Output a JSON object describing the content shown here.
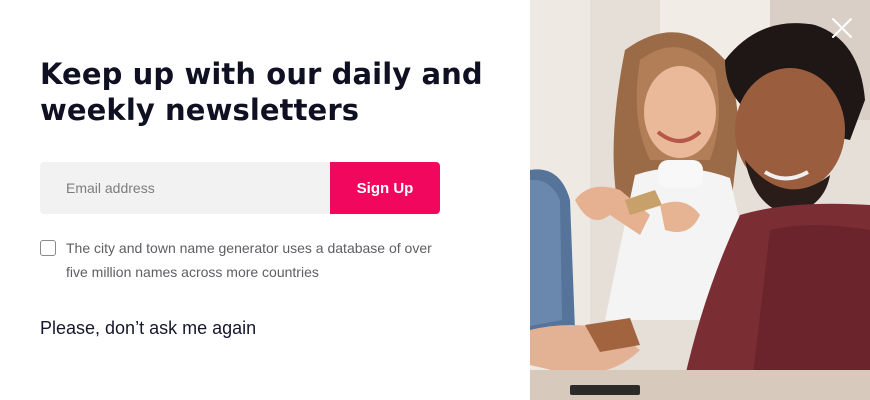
{
  "newsletter": {
    "headline": "Keep up with our daily and weekly newsletters",
    "email_placeholder": "Email address",
    "email_value": "",
    "signup_label": "Sign Up",
    "consent_text": "The city and town name generator uses a database of over five million names across more countries",
    "consent_checked": false,
    "dont_ask_label": "Please, don’t ask me again"
  },
  "photo": {
    "description_icon": "people-smiling-photo"
  },
  "close": {
    "icon": "close-icon"
  },
  "colors": {
    "accent": "#f2075e",
    "headline": "#0f1022",
    "input_bg": "#f2f2f2",
    "muted_text": "#5e5e63"
  }
}
